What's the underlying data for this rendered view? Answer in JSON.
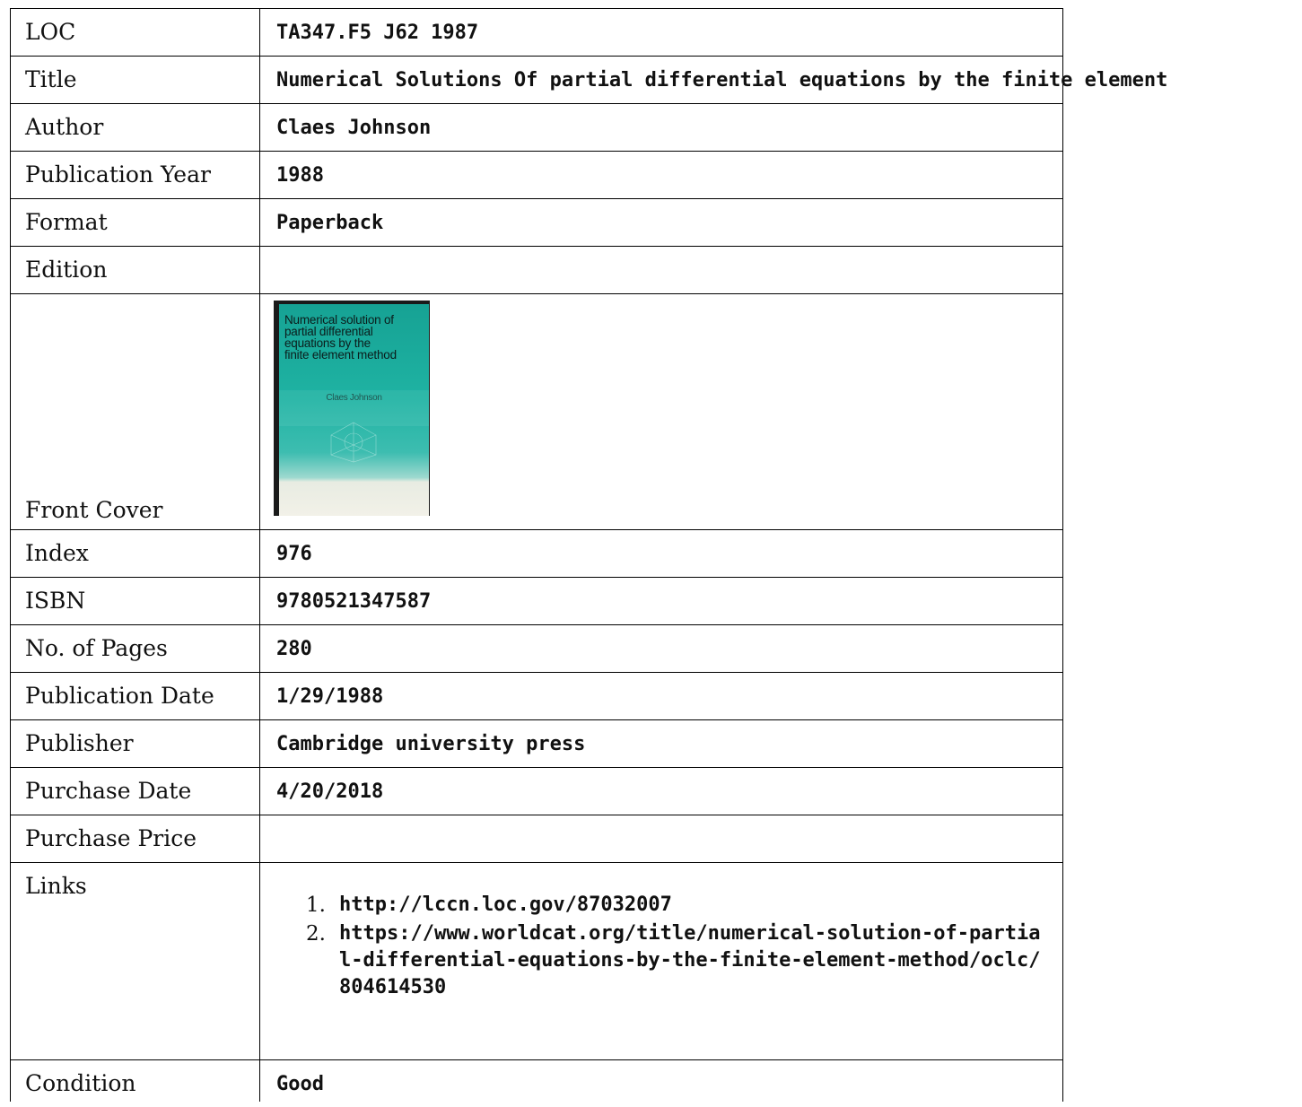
{
  "record": {
    "loc": {
      "label": "LOC",
      "value": "TA347.F5 J62 1987"
    },
    "title": {
      "label": "Title",
      "value": "Numerical Solutions Of partial differential equations by the finite element"
    },
    "author": {
      "label": "Author",
      "value": "Claes Johnson"
    },
    "publication_year": {
      "label": "Publication Year",
      "value": "1988"
    },
    "format": {
      "label": "Format",
      "value": "Paperback"
    },
    "edition": {
      "label": "Edition",
      "value": ""
    },
    "front_cover": {
      "label": "Front Cover",
      "book_title": "Numerical solution of\npartial differential\nequations by the\nfinite element method",
      "book_author": "Claes Johnson",
      "colors": {
        "cover": "#1fb3a3",
        "bottom_band": "#f2f1e8"
      }
    },
    "index": {
      "label": "Index",
      "value": "976"
    },
    "isbn": {
      "label": "ISBN",
      "value": "9780521347587"
    },
    "pages": {
      "label": "No. of Pages",
      "value": "280"
    },
    "publication_date": {
      "label": "Publication Date",
      "value": "1/29/1988"
    },
    "publisher": {
      "label": "Publisher",
      "value": "Cambridge university press"
    },
    "purchase_date": {
      "label": "Purchase Date",
      "value": "4/20/2018"
    },
    "purchase_price": {
      "label": "Purchase Price",
      "value": ""
    },
    "links": {
      "label": "Links",
      "items": [
        {
          "num": "1.",
          "url": "http://lccn.loc.gov/87032007"
        },
        {
          "num": "2.",
          "url": "https://www.worldcat.org/title/numerical-solution-of-partial-differential-equations-by-the-finite-element-method/oclc/804614530"
        }
      ]
    },
    "condition": {
      "label": "Condition",
      "value": "Good"
    }
  }
}
